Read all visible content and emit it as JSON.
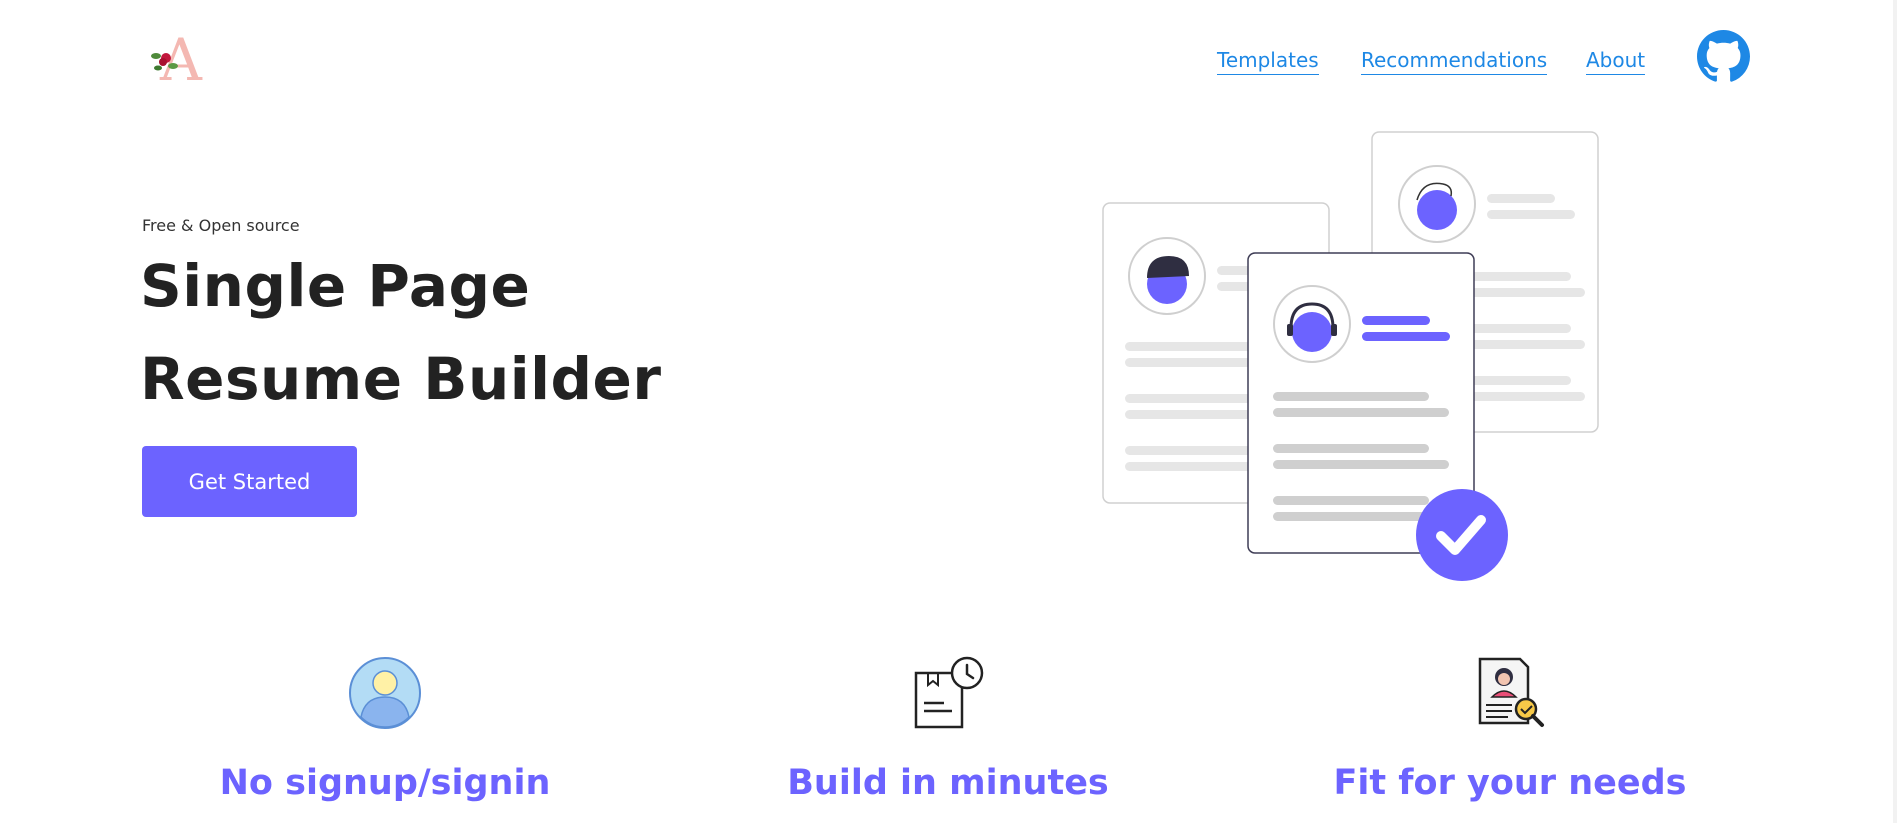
{
  "header": {
    "logo": {
      "icon": "rose-monogram-logo",
      "letter": "A"
    },
    "nav": [
      {
        "label": "Templates"
      },
      {
        "label": "Recommendations"
      },
      {
        "label": "About"
      }
    ],
    "github": {
      "icon": "github-icon"
    }
  },
  "hero": {
    "tagline": "Free & Open source",
    "title_line1": "Single Page",
    "title_line2": "Resume Builder",
    "cta_label": "Get Started"
  },
  "features": [
    {
      "icon": "user-avatar-icon",
      "title": "No signup/signin"
    },
    {
      "icon": "document-clock-icon",
      "title": "Build in minutes"
    },
    {
      "icon": "resume-search-icon",
      "title": "Fit for your needs"
    }
  ],
  "colors": {
    "accent": "#6c63ff",
    "link": "#1e88e5",
    "text": "#222222"
  }
}
